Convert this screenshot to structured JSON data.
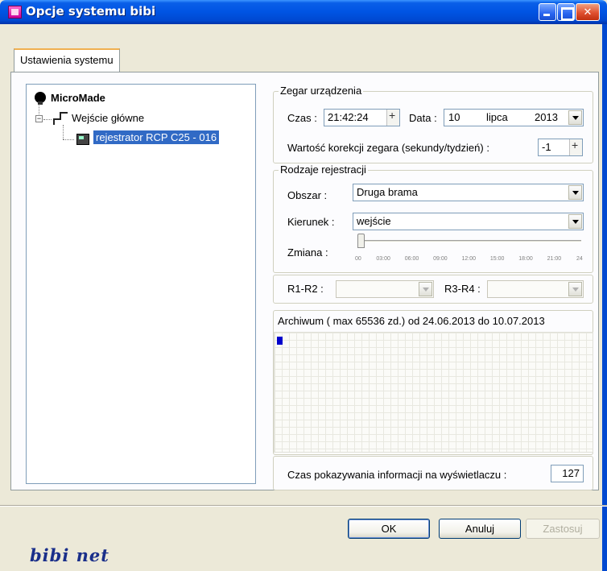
{
  "window": {
    "title": "Opcje systemu bibi"
  },
  "tabs": [
    {
      "label": "Ustawienia systemu"
    }
  ],
  "tree": {
    "root": "MicroMade",
    "child": "Wejście główne",
    "leaf": "rejestrator RCP C25 - 016"
  },
  "clock": {
    "legend": "Zegar urządzenia",
    "time_label": "Czas :",
    "time_value": "21:42:24",
    "date_label": "Data :",
    "date_day": "10",
    "date_month": "lipca",
    "date_year": "2013",
    "correction_label": "Wartość korekcji zegara (sekundy/tydzień) :",
    "correction_value": "-1"
  },
  "registration": {
    "legend": "Rodzaje rejestracji",
    "area_label": "Obszar :",
    "area_value": "Druga brama",
    "direction_label": "Kierunek :",
    "direction_value": "wejście",
    "shift_label": "Zmiana :",
    "shift_ticks": [
      "00",
      "03:00",
      "06:00",
      "09:00",
      "12:00",
      "15:00",
      "18:00",
      "21:00",
      "24"
    ],
    "shift_value_fraction": 0.0
  },
  "relays": {
    "r1r2_label": "R1-R2 :",
    "r3r4_label": "R3-R4 :"
  },
  "archive": {
    "header": "Archiwum ( max 65536 zd.) od 24.06.2013 do 10.07.2013"
  },
  "display": {
    "label": "Czas pokazywania informacji na wyświetlaczu :",
    "value": "127"
  },
  "buttons": {
    "ok": "OK",
    "cancel": "Anuluj",
    "apply": "Zastosuj"
  },
  "brand": {
    "logo_text": "bibi net",
    "color": "#1a2f8a"
  },
  "colors": {
    "title_bar": "#0054e3",
    "selection": "#316ac5"
  }
}
